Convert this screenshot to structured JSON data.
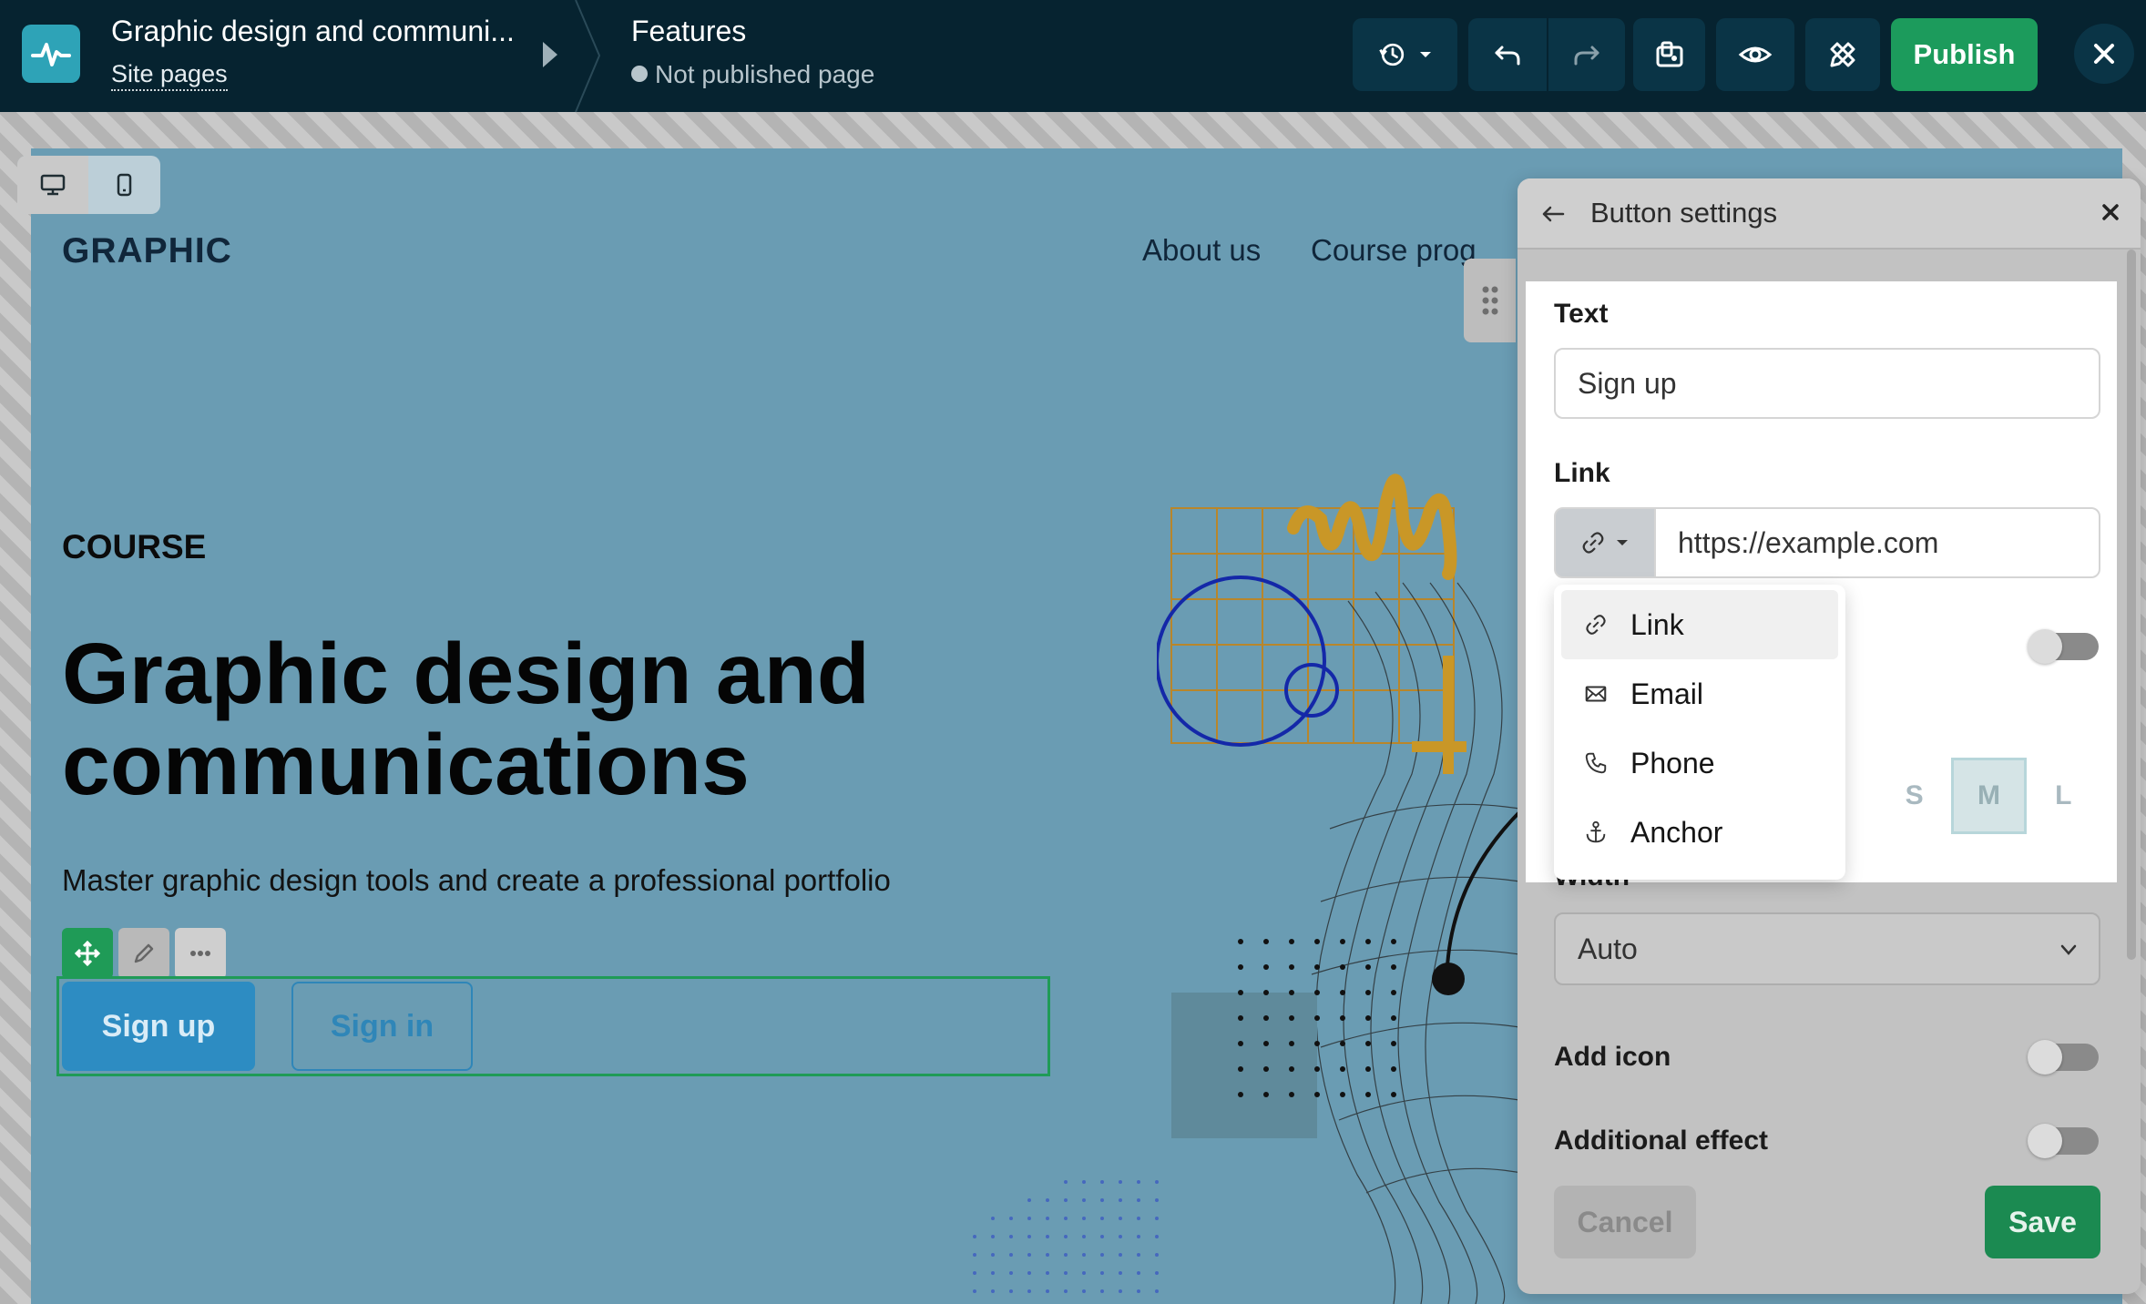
{
  "topbar": {
    "site_title": "Graphic design and communi...",
    "site_pages_link": "Site pages",
    "page_name": "Features",
    "page_status": "Not published page",
    "publish_label": "Publish"
  },
  "canvas": {
    "brand": "GRAPHIC",
    "nav": [
      "About us",
      "Course prog"
    ],
    "course_label": "COURSE",
    "hero_title_line1": "Graphic design and",
    "hero_title_line2": "communications",
    "hero_subtitle": "Master graphic design tools and create a professional portfolio",
    "primary_button": "Sign up",
    "secondary_button": "Sign in"
  },
  "panel": {
    "title": "Button settings",
    "text_label": "Text",
    "text_value": "Sign up",
    "link_label": "Link",
    "link_placeholder": "https://example.com",
    "sizes": [
      "S",
      "M",
      "L"
    ],
    "selected_size": "M",
    "width_label": "Width",
    "width_value": "Auto",
    "add_icon_label": "Add icon",
    "additional_effect_label": "Additional effect",
    "cancel_label": "Cancel",
    "save_label": "Save"
  },
  "link_type_menu": {
    "items": [
      {
        "label": "Link",
        "icon": "link-icon",
        "highlighted": true
      },
      {
        "label": "Email",
        "icon": "envelope-icon"
      },
      {
        "label": "Phone",
        "icon": "phone-icon"
      },
      {
        "label": "Anchor",
        "icon": "anchor-icon"
      }
    ]
  },
  "colors": {
    "topbar_bg": "#062330",
    "publish_green": "#1c9b5c",
    "page_bg": "#6a9cb3",
    "selection_green": "#1f9b57",
    "button_blue": "#2d8cc2"
  }
}
